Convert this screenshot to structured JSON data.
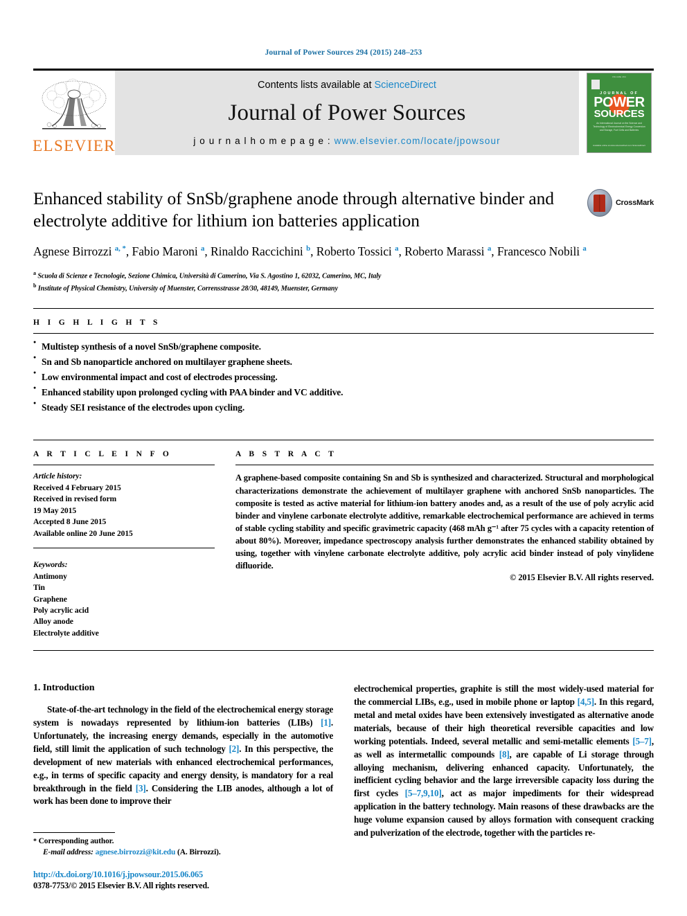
{
  "running_head": "Journal of Power Sources 294 (2015) 248–253",
  "banner": {
    "publisher_name": "ELSEVIER",
    "contents_prefix": "Contents lists available at ",
    "contents_link": "ScienceDirect",
    "journal_name": "Journal of Power Sources",
    "homepage_prefix": "j o u r n a l   h o m e p a g e :  ",
    "homepage_url": "www.elsevier.com/locate/jpowsour",
    "cover": {
      "journal_of": "JOURNAL OF",
      "power": "POWER",
      "sources": "SOURCES",
      "subtitle": "An International Journal on the Science and Technology of Electrochemical Energy Conversion and Storage, Fuel Cells and Batteries",
      "bottom": "Available online at www.sciencedirect.com ScienceDirect"
    }
  },
  "article": {
    "title": "Enhanced stability of SnSb/graphene anode through alternative binder and electrolyte additive for lithium ion batteries application",
    "crossmark_label": "CrossMark",
    "authors_html": "Agnese Birrozzi <sup class=\"aff-mark\">a, *</sup>, Fabio Maroni <sup class=\"aff-mark\">a</sup>, Rinaldo Raccichini <sup class=\"aff-mark\">b</sup>, Roberto Tossici <sup class=\"aff-mark\">a</sup>, Roberto Marassi <sup class=\"aff-mark\">a</sup>, Francesco Nobili <sup class=\"aff-mark\">a</sup>",
    "affiliations": [
      {
        "mark": "a",
        "text": "Scuola di Scienze e Tecnologie, Sezione Chimica, Università di Camerino, Via S. Agostino 1, 62032, Camerino, MC, Italy"
      },
      {
        "mark": "b",
        "text": "Institute of Physical Chemistry, University of Muenster, Corrensstrasse 28/30, 48149, Muenster, Germany"
      }
    ]
  },
  "highlights": {
    "heading": "H I G H L I G H T S",
    "items": [
      "Multistep synthesis of a novel SnSb/graphene composite.",
      "Sn and Sb nanoparticle anchored on multilayer graphene sheets.",
      "Low environmental impact and cost of electrodes processing.",
      "Enhanced stability upon prolonged cycling with PAA binder and VC additive.",
      "Steady SEI resistance of the electrodes upon cycling."
    ]
  },
  "article_info": {
    "heading": "A R T I C L E   I N F O",
    "history_label": "Article history:",
    "history": [
      "Received 4 February 2015",
      "Received in revised form",
      "19 May 2015",
      "Accepted 8 June 2015",
      "Available online 20 June 2015"
    ],
    "keywords_label": "Keywords:",
    "keywords": [
      "Antimony",
      "Tin",
      "Graphene",
      "Poly acrylic acid",
      "Alloy anode",
      "Electrolyte additive"
    ]
  },
  "abstract": {
    "heading": "A B S T R A C T",
    "text": "A graphene-based composite containing Sn and Sb is synthesized and characterized. Structural and morphological characterizations demonstrate the achievement of multilayer graphene with anchored SnSb nanoparticles. The composite is tested as active material for lithium-ion battery anodes and, as a result of the use of poly acrylic acid binder and vinylene carbonate electrolyte additive, remarkable electrochemical performance are achieved in terms of stable cycling stability and specific gravimetric capacity (468 mAh g⁻¹ after 75 cycles with a capacity retention of about 80%). Moreover, impedance spectroscopy analysis further demonstrates the enhanced stability obtained by using, together with vinylene carbonate electrolyte additive, poly acrylic acid binder instead of poly vinylidene difluoride.",
    "copyright": "© 2015 Elsevier B.V. All rights reserved."
  },
  "body": {
    "section_number_title": "1.  Introduction",
    "left_paragraph_html": "State-of-the-art technology in the field of the electrochemical energy storage system is nowadays represented by lithium-ion batteries (LIBs) <span class=\"ref\">[1]</span>. Unfortunately, the increasing energy demands, especially in the automotive field, still limit the application of such technology <span class=\"ref\">[2]</span>. In this perspective, the development of new materials with enhanced electrochemical performances, e.g., in terms of specific capacity and energy density, is mandatory for a real breakthrough in the field <span class=\"ref\">[3]</span>. Considering the LIB anodes, although a lot of work has been done to improve their",
    "right_paragraph_html": "electrochemical properties, graphite is still the most widely-used material for the commercial LIBs, e.g., used in mobile phone or laptop <span class=\"ref\">[4,5]</span>. In this regard, metal and metal oxides have been extensively investigated as alternative anode materials, because of their high theoretical reversible capacities and low working potentials. Indeed, several metallic and semi-metallic elements <span class=\"ref\">[5–7]</span>, as well as intermetallic compounds <span class=\"ref\">[8]</span>, are capable of Li storage through alloying mechanism, delivering enhanced capacity. Unfortunately, the inefficient cycling behavior and the large irreversible capacity loss during the first cycles <span class=\"ref\">[5–7,9,10]</span>, act as major impediments for their widespread application in the battery technology. Main reasons of these drawbacks are the huge volume expansion caused by alloys formation with consequent cracking and pulverization of the electrode, together with the particles re-"
  },
  "footer": {
    "corresponding_star": "*",
    "corresponding_label": "Corresponding author.",
    "email_label": "E-mail address:",
    "email": "agnese.birrozzi@kit.edu",
    "email_attribution": "(A. Birrozzi).",
    "doi": "http://dx.doi.org/10.1016/j.jpowsour.2015.06.065",
    "issn_line": "0378-7753/© 2015 Elsevier B.V. All rights reserved."
  },
  "colors": {
    "link_blue": "#1a87c8",
    "running_head_blue": "#1a6fa3",
    "elsevier_orange": "#E87722",
    "banner_grey": "#e3e3e3",
    "cover_green": "#3e8f3e",
    "crossmark_red": "#B02A18"
  }
}
